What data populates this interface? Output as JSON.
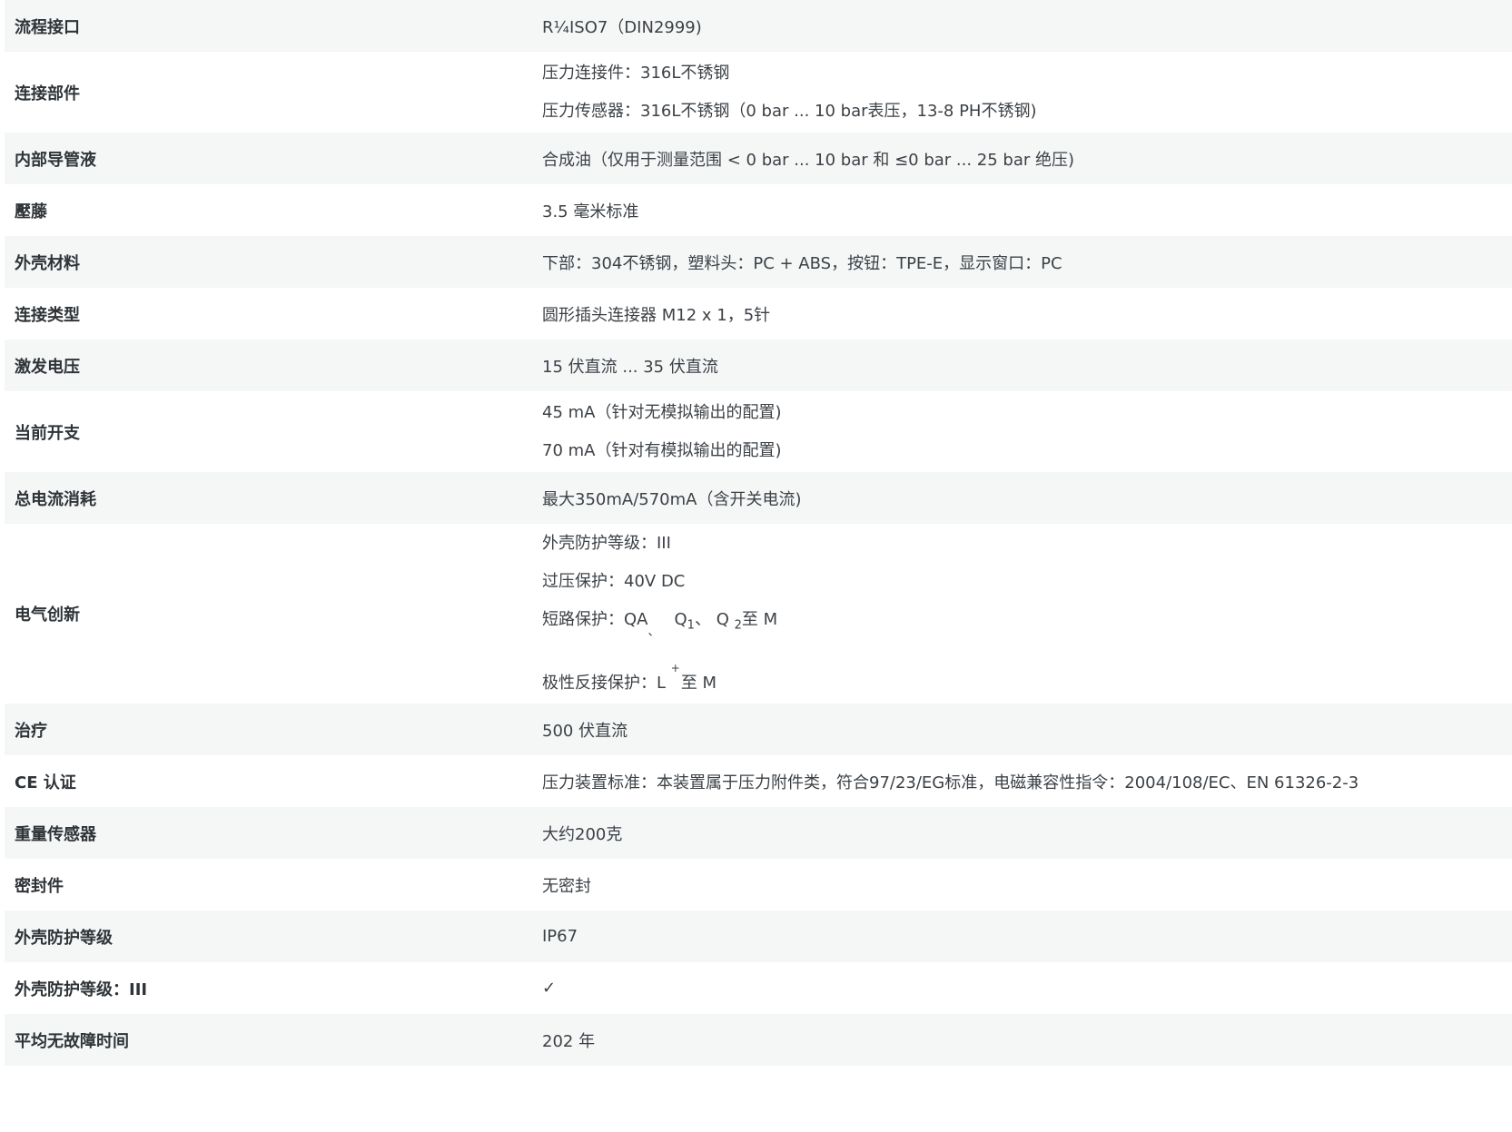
{
  "rows": [
    {
      "label": "流程接口",
      "values": [
        "R¼ISO7（DIN2999)"
      ]
    },
    {
      "label": "连接部件",
      "values": [
        "压力连接件：316L不锈钢",
        "压力传感器：316L不锈钢（0 bar ... 10 bar表压，13-8 PH不锈钢)"
      ]
    },
    {
      "label": "内部导管液",
      "values": [
        "合成油（仅用于测量范围 < 0 bar ... 10 bar 和 ≤0 bar ... 25 bar 绝压)"
      ]
    },
    {
      "label": "壓藤",
      "values": [
        "3.5 毫米标准"
      ]
    },
    {
      "label": "外壳材料",
      "values": [
        "下部：304不锈钢，塑料头：PC + ABS，按钮：TPE-E，显示窗口：PC"
      ]
    },
    {
      "label": "连接类型",
      "values": [
        "圆形插头连接器 M12 x 1，5针"
      ]
    },
    {
      "label": "激发电压",
      "values": [
        "15 伏直流 ... 35 伏直流"
      ]
    },
    {
      "label": "当前开支",
      "values": [
        "45 mA（针对无模拟输出的配置)",
        "70 mA（针对有模拟输出的配置)"
      ]
    },
    {
      "label": "总电流消耗",
      "values": [
        "最大350mA/570mA（含开关电流)"
      ]
    },
    {
      "label": "治疗",
      "values": [
        "500 伏直流"
      ]
    },
    {
      "label": "CE 认证",
      "values": [
        "压力装置标准：本装置属于压力附件类，符合97/23/EG标准，电磁兼容性指令：2004/108/EC、EN 61326-2-3"
      ]
    },
    {
      "label": "重量传感器",
      "values": [
        "大约200克"
      ]
    },
    {
      "label": "密封件",
      "values": [
        "无密封"
      ]
    },
    {
      "label": "外壳防护等级",
      "values": [
        "IP67"
      ]
    },
    {
      "label": "外壳防护等级：III",
      "values": [
        "✓"
      ]
    },
    {
      "label": "平均无故障时间",
      "values": [
        "202 年"
      ]
    }
  ],
  "electrical": {
    "label": "电气创新",
    "line1": "外壳防护等级：III",
    "line2": "过压保护：40V DC",
    "sc_prefix": "短路保护：QA",
    "sc_qa_sub": "、",
    "sc_q": "Q",
    "sc_sub1": "1",
    "sc_sep": "、",
    "sc_q2": "Q",
    "sc_sub2": "2",
    "sc_suffix": "至 M",
    "rp_prefix": "极性反接保护：L",
    "rp_sup": "+",
    "rp_suffix": "至 M"
  }
}
